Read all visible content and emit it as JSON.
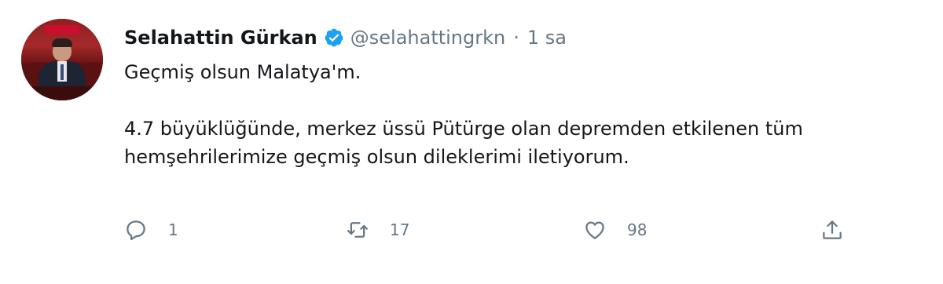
{
  "tweet": {
    "author_name": "Selahattin Gürkan",
    "handle": "@selahattingrkn",
    "separator": "·",
    "time": "1 sa",
    "verified": true,
    "text_line1": "Geçmiş olsun Malatya'm.",
    "text_line2": "4.7 büyüklüğünde, merkez üssü Pütürge olan depremden etkilenen tüm",
    "text_line3": "hemşehrilerimize geçmiş olsun dileklerimi iletiyorum."
  },
  "actions": {
    "reply_count": "1",
    "retweet_count": "17",
    "like_count": "98"
  },
  "colors": {
    "verified_blue": "#1da1f2",
    "muted_gray": "#657786",
    "text": "#14171a"
  },
  "icons": {
    "reply": "reply-icon",
    "retweet": "retweet-icon",
    "like": "like-icon",
    "share": "share-icon",
    "verified": "verified-badge-icon"
  }
}
